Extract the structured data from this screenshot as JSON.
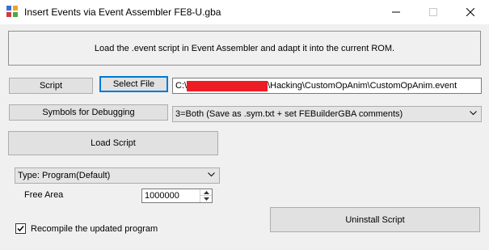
{
  "window": {
    "title": "Insert Events via Event Assembler FE8-U.gba",
    "icon": "app-icon",
    "controls": [
      "minimize-icon",
      "maximize-icon",
      "close-icon"
    ]
  },
  "banner": {
    "text": "Load the .event script in Event Assembler and adapt it into the current ROM."
  },
  "script_row": {
    "script_label": "Script",
    "select_file_label": "Select File",
    "path_prefix": "C:\\",
    "path_suffix": "\\Hacking\\CustomOpAnim\\CustomOpAnim.event"
  },
  "symbols_row": {
    "label": "Symbols for Debugging",
    "selected": "3=Both (Save as .sym.txt + set FEBuilderGBA comments)"
  },
  "load_script": {
    "label": "Load Script"
  },
  "type_select": {
    "selected": "Type: Program(Default)"
  },
  "free_area": {
    "label": "Free Area",
    "value": "1000000"
  },
  "recompile": {
    "label": "Recompile the updated program",
    "checked": true
  },
  "uninstall": {
    "label": "Uninstall Script"
  },
  "colors": {
    "redaction": "#ee1c24",
    "focus_border": "#0078d7"
  }
}
